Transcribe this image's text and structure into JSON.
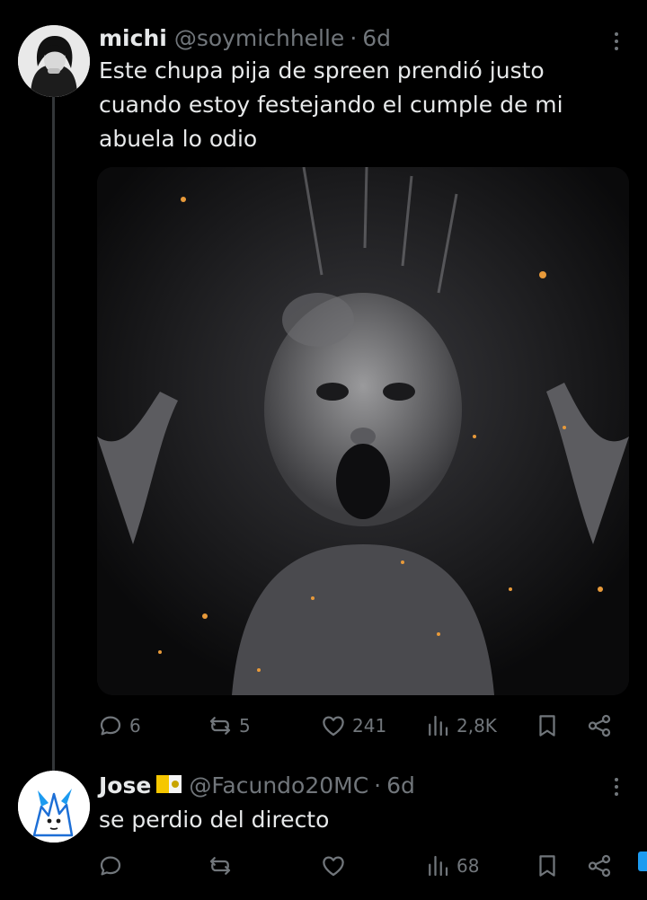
{
  "post": {
    "author_name": "michi",
    "handle": "@soymichhelle",
    "separator": "·",
    "time": "6d",
    "text": "Este chupa pija de spreen prendió justo cuando estoy festejando el cumple de mi abuela lo odio",
    "media_description_icon": "image",
    "stats": {
      "replies": "6",
      "reposts": "5",
      "likes": "241",
      "views": "2,8K"
    }
  },
  "reply": {
    "author_name": "Jose",
    "flag_icon": "vatican-flag",
    "handle": "@Facundo20MC",
    "separator": "·",
    "time": "6d",
    "text": "se perdio del directo",
    "stats": {
      "views": "68"
    }
  },
  "colors": {
    "background": "#000000",
    "primary_text": "#e7e9ea",
    "secondary_text": "#71767b",
    "thread_line": "#333639",
    "accent": "#1d9bf0"
  }
}
